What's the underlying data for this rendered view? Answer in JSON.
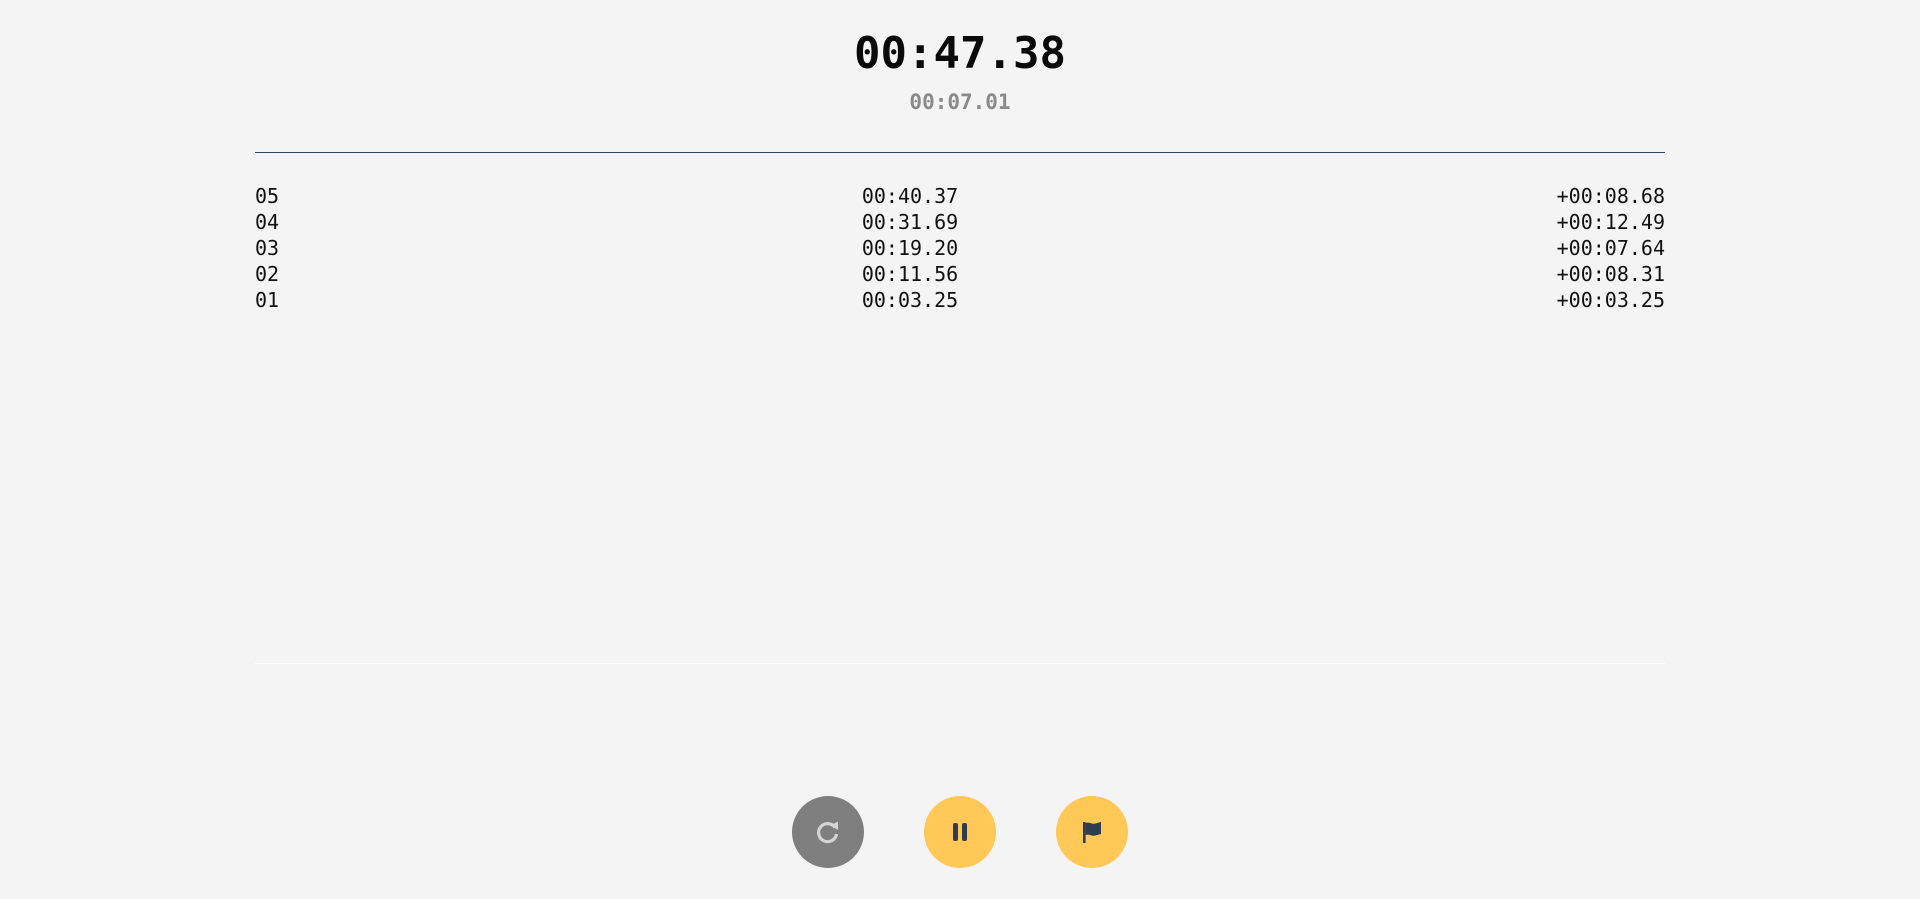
{
  "timer": {
    "main": "00:47.38",
    "lap": "00:07.01"
  },
  "laps": [
    {
      "number": "05",
      "total": "00:40.37",
      "diff": "+00:08.68"
    },
    {
      "number": "04",
      "total": "00:31.69",
      "diff": "+00:12.49"
    },
    {
      "number": "03",
      "total": "00:19.20",
      "diff": "+00:07.64"
    },
    {
      "number": "02",
      "total": "00:11.56",
      "diff": "+00:08.31"
    },
    {
      "number": "01",
      "total": "00:03.25",
      "diff": "+00:03.25"
    }
  ],
  "controls": {
    "reset_icon": "reset-icon",
    "pause_icon": "pause-icon",
    "lap_icon": "flag-icon"
  },
  "colors": {
    "background": "#f4f4f4",
    "accent": "#ffc857",
    "reset_button": "#7f7f7f",
    "icon_dark": "#2e3e4e",
    "divider": "#2e4660"
  }
}
